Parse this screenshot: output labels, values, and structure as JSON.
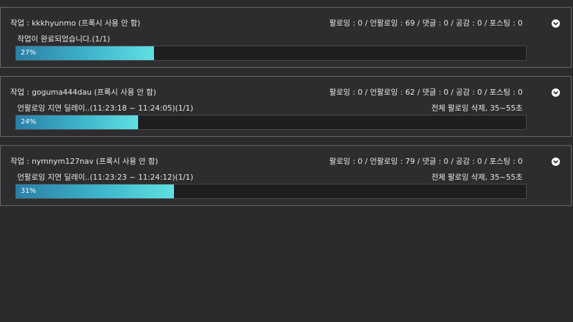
{
  "tasks": [
    {
      "title": "작업 : kkkhyunmo (프록시 사용 안 함)",
      "stats": "팔로잉 : 0 / 언팔로잉 : 69 / 댓글 : 0 / 공감 : 0 / 포스팅 : 0",
      "status": "작업이 완료되었습니다.(1/1)",
      "note": "",
      "progress_label": "27%",
      "progress": 0.27
    },
    {
      "title": "작업 : goguma444dau (프록시 사용 안 함)",
      "stats": "팔로잉 : 0 / 언팔로잉 : 62 / 댓글 : 0 / 공감 : 0 / 포스팅 : 0",
      "status": "언팔로잉 지연 딜레이..(11:23:18 ~ 11:24:05)(1/1)",
      "note": "전체 팔로잉 삭제, 35~55초",
      "progress_label": "24%",
      "progress": 0.24
    },
    {
      "title": "작업 : nymnym127nav (프록시 사용 안 함)",
      "stats": "팔로잉 : 0 / 언팔로잉 : 79 / 댓글 : 0 / 공감 : 0 / 포스팅 : 0",
      "status": "언팔로잉 지연 딜레이..(11:23:23 ~ 11:24:12)(1/1)",
      "note": "전체 팔로잉 삭제, 35~55초",
      "progress_label": "31%",
      "progress": 0.31
    }
  ],
  "icons": {
    "expand": "chevron-down-circle-icon"
  },
  "colors": {
    "background": "#2b2b2d",
    "bar_start": "#2a7fa6",
    "bar_end": "#5fe0e0"
  }
}
